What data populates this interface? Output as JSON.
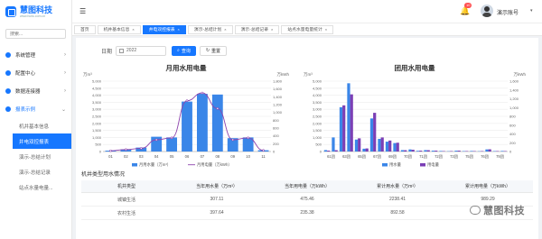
{
  "app": {
    "logo_title": "慧图科技",
    "logo_sub": "www.huitu.com.cn"
  },
  "sidebar": {
    "search_placeholder": "搜索...",
    "items": [
      {
        "label": "系统管理"
      },
      {
        "label": "配置中心"
      },
      {
        "label": "数据连接器"
      },
      {
        "label": "报表示例"
      }
    ],
    "sub_items": [
      {
        "label": "机井基本信息"
      },
      {
        "label": "井电双控报表"
      },
      {
        "label": "演示-总结计划"
      },
      {
        "label": "演示-总结记录"
      },
      {
        "label": "站点水量电量..."
      }
    ]
  },
  "header": {
    "badge": "10",
    "user": "演示账号"
  },
  "tabs": [
    {
      "label": "首页"
    },
    {
      "label": "机井基本信息"
    },
    {
      "label": "井电双控报表"
    },
    {
      "label": "演示-总结计划"
    },
    {
      "label": "演示-总结记录"
    },
    {
      "label": "站点水量电量统计"
    }
  ],
  "filters": {
    "date_label": "日期",
    "date_value": "2022",
    "query_label": "查询",
    "reset_label": "重置"
  },
  "chart_data": [
    {
      "type": "bar",
      "title": "月用水用电量",
      "left_unit": "万m³",
      "right_unit": "万kWh",
      "categories": [
        "01",
        "02",
        "03",
        "04",
        "05",
        "06",
        "07",
        "08",
        "09",
        "10",
        "11"
      ],
      "left_ticks": [
        "0",
        "500",
        "1,000",
        "1,500",
        "2,000",
        "2,500",
        "3,000",
        "3,500",
        "4,000",
        "4,500",
        "5,000"
      ],
      "right_ticks": [
        "0",
        "200",
        "400",
        "600",
        "800",
        "1,000",
        "1,200",
        "1,400",
        "1,600",
        "1,800"
      ],
      "ylim_left": [
        0,
        5000
      ],
      "ylim_right": [
        0,
        1800
      ],
      "series": [
        {
          "name": "月用水量（万m³）",
          "kind": "bar",
          "axis": "left",
          "color": "#3a86e8",
          "values": [
            60,
            150,
            280,
            1050,
            1000,
            3550,
            4100,
            4050,
            950,
            1000,
            90
          ]
        },
        {
          "name": "月用电量（万kWh）",
          "kind": "line",
          "axis": "right",
          "color": "#8e44ad",
          "values": [
            20,
            50,
            80,
            300,
            350,
            1300,
            1500,
            1100,
            300,
            350,
            30
          ]
        }
      ]
    },
    {
      "type": "bar",
      "title": "团用水用电量",
      "left_unit": "万m³",
      "right_unit": "万kWh",
      "categories": [
        "61团",
        "63团",
        "65团",
        "67团",
        "69团",
        "70团",
        "71团",
        "72团",
        "73团",
        "75团",
        "76团",
        "79团"
      ],
      "left_ticks": [
        "0",
        "500",
        "1,000",
        "1,500",
        "2,000",
        "2,500",
        "3,000",
        "3,500",
        "4,000",
        "4,500",
        "5,000"
      ],
      "right_ticks": [
        "0",
        "200",
        "400",
        "600",
        "800",
        "1,000",
        "1,200",
        "1,400",
        "1,600"
      ],
      "ylim_left": [
        0,
        5000
      ],
      "ylim_right": [
        0,
        1600
      ],
      "series": [
        {
          "name": "用水量",
          "kind": "bar",
          "axis": "left",
          "color": "#3a86e8",
          "values": [
            100,
            1000,
            3150,
            4850,
            850,
            200,
            2350,
            900,
            700,
            600,
            100,
            150,
            50,
            100,
            60,
            40,
            20,
            60,
            30,
            40,
            20,
            150,
            30,
            40
          ]
        },
        {
          "name": "用电量",
          "kind": "bar",
          "axis": "right",
          "color": "#7b3fb5",
          "values": [
            20,
            30,
            1050,
            1300,
            300,
            70,
            880,
            320,
            250,
            200,
            30,
            40,
            20,
            30,
            20,
            10,
            10,
            20,
            10,
            10,
            10,
            50,
            10,
            10
          ]
        }
      ]
    }
  ],
  "section": {
    "title": "机井类型用水情况"
  },
  "table": {
    "columns": [
      "机井类型",
      "当年用水量（万m³）",
      "当年用电量（万kWh）",
      "累计用水量（万m³）",
      "累计用电量（万kWh）"
    ],
    "rows": [
      [
        "城镇生活",
        "307.11",
        "475.46",
        "2238.41",
        "989.29"
      ],
      [
        "农村生活",
        "397.64",
        "235.38",
        "892.58",
        "..."
      ]
    ]
  },
  "watermark": {
    "text": "慧图科技"
  }
}
